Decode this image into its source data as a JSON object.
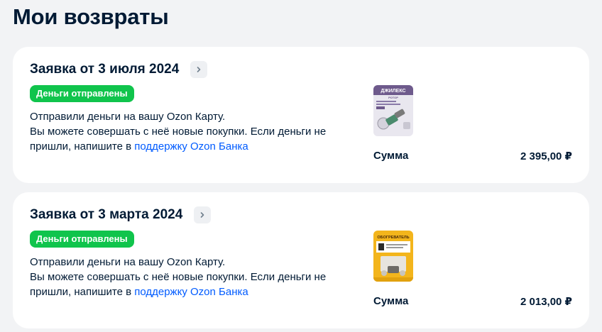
{
  "page": {
    "title": "Мои возвраты"
  },
  "returns": [
    {
      "title": "Заявка от 3 июля 2024",
      "status": "Деньги отправлены",
      "message_line1": "Отправили деньги на вашу Ozon Карту.",
      "message_line2": "Вы можете совершать с неё новые покупки. Если деньги не пришли, напишите в ",
      "support_link": "поддержку Ozon Банка",
      "product_label": "ДЖИЛЕКС",
      "product_sublabel": "РОТОР",
      "sum_label": "Сумма",
      "sum_value": "2 395,00 ₽"
    },
    {
      "title": "Заявка от 3 марта 2024",
      "status": "Деньги отправлены",
      "message_line1": "Отправили деньги на вашу Ozon Карту.",
      "message_line2": "Вы можете совершать с неё новые покупки. Если деньги не пришли, напишите в ",
      "support_link": "поддержку Ozon Банка",
      "product_label": "ОБОГРЕВАТЕЛЬ",
      "sum_label": "Сумма",
      "sum_value": "2 013,00 ₽"
    }
  ],
  "colors": {
    "status_green": "#10c44c",
    "link_blue": "#005bff",
    "page_bg": "#f2f3f5"
  }
}
